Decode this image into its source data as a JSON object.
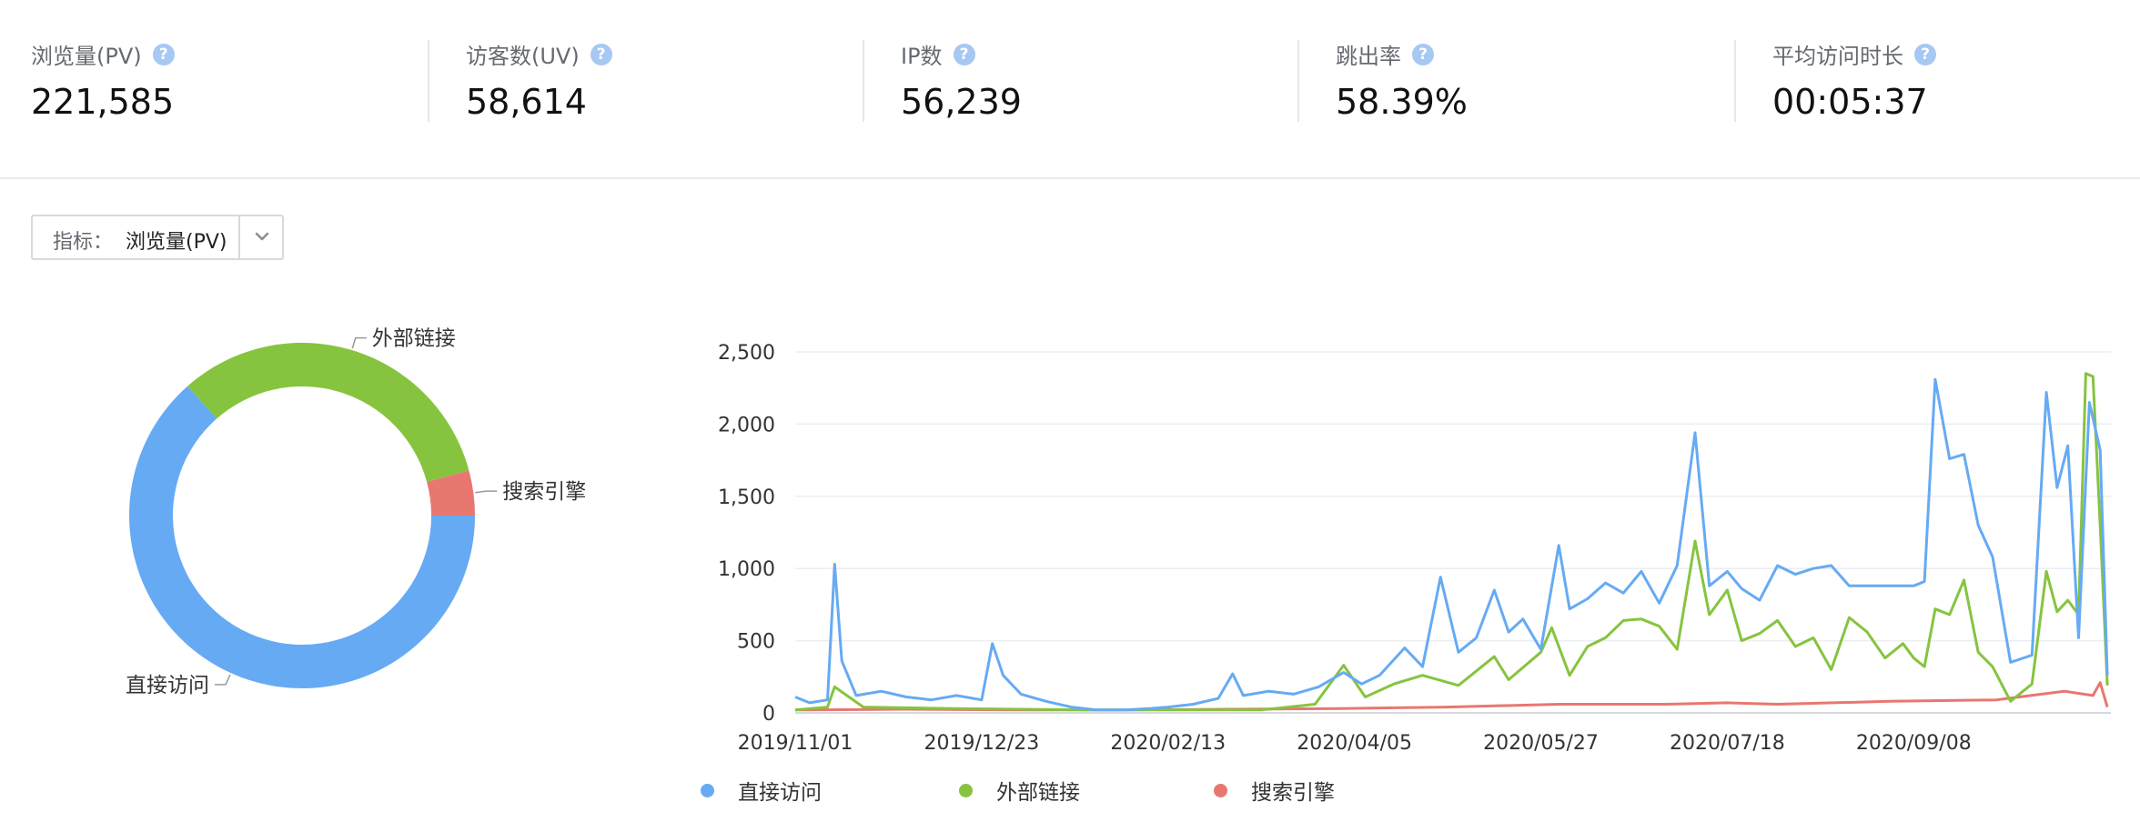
{
  "stats": [
    {
      "label": "浏览量(PV)",
      "value": "221,585"
    },
    {
      "label": "访客数(UV)",
      "value": "58,614"
    },
    {
      "label": "IP数",
      "value": "56,239"
    },
    {
      "label": "跳出率",
      "value": "58.39%"
    },
    {
      "label": "平均访问时长",
      "value": "00:05:37"
    }
  ],
  "metric_selector": {
    "prefix": "指标：",
    "value": "浏览量(PV)"
  },
  "chart_data": [
    {
      "type": "pie",
      "variant": "donut",
      "slices": [
        {
          "name": "直接访问",
          "value": 63.5,
          "color": "#66aaf4"
        },
        {
          "name": "外部链接",
          "value": 32.3,
          "color": "#86c43f"
        },
        {
          "name": "搜索引擎",
          "value": 4.2,
          "color": "#e87770"
        }
      ],
      "labels_outside": true
    },
    {
      "type": "line",
      "x_range": [
        "2019/11/01",
        "2020/11/02"
      ],
      "x_tick_labels": [
        "2019/11/01",
        "2019/12/23",
        "2020/02/13",
        "2020/04/05",
        "2020/05/27",
        "2020/07/18",
        "2020/09/08"
      ],
      "y_ticks": [
        "0",
        "500",
        "1,000",
        "1,500",
        "2,000",
        "2,500"
      ],
      "ylim": [
        0,
        2500
      ],
      "grid": "horizontal",
      "legend_position": "bottom",
      "series": [
        {
          "name": "直接访问",
          "color": "#66aaf4",
          "points": [
            [
              "2019/11/01",
              110
            ],
            [
              "2019/11/05",
              70
            ],
            [
              "2019/11/10",
              90
            ],
            [
              "2019/11/12",
              1030
            ],
            [
              "2019/11/14",
              360
            ],
            [
              "2019/11/18",
              120
            ],
            [
              "2019/11/25",
              150
            ],
            [
              "2019/12/02",
              110
            ],
            [
              "2019/12/09",
              90
            ],
            [
              "2019/12/16",
              120
            ],
            [
              "2019/12/23",
              90
            ],
            [
              "2019/12/26",
              480
            ],
            [
              "2019/12/29",
              260
            ],
            [
              "2020/01/03",
              130
            ],
            [
              "2020/01/10",
              80
            ],
            [
              "2020/01/17",
              40
            ],
            [
              "2020/01/24",
              20
            ],
            [
              "2020/02/01",
              20
            ],
            [
              "2020/02/08",
              30
            ],
            [
              "2020/02/13",
              40
            ],
            [
              "2020/02/20",
              60
            ],
            [
              "2020/02/27",
              100
            ],
            [
              "2020/03/02",
              270
            ],
            [
              "2020/03/05",
              120
            ],
            [
              "2020/03/12",
              150
            ],
            [
              "2020/03/19",
              130
            ],
            [
              "2020/03/26",
              180
            ],
            [
              "2020/04/02",
              280
            ],
            [
              "2020/04/07",
              200
            ],
            [
              "2020/04/12",
              260
            ],
            [
              "2020/04/19",
              450
            ],
            [
              "2020/04/24",
              320
            ],
            [
              "2020/04/29",
              940
            ],
            [
              "2020/05/04",
              420
            ],
            [
              "2020/05/09",
              520
            ],
            [
              "2020/05/14",
              850
            ],
            [
              "2020/05/18",
              560
            ],
            [
              "2020/05/22",
              650
            ],
            [
              "2020/05/27",
              440
            ],
            [
              "2020/06/01",
              1160
            ],
            [
              "2020/06/04",
              720
            ],
            [
              "2020/06/09",
              790
            ],
            [
              "2020/06/14",
              900
            ],
            [
              "2020/06/19",
              830
            ],
            [
              "2020/06/24",
              980
            ],
            [
              "2020/06/29",
              760
            ],
            [
              "2020/07/04",
              1020
            ],
            [
              "2020/07/09",
              1940
            ],
            [
              "2020/07/13",
              880
            ],
            [
              "2020/07/18",
              980
            ],
            [
              "2020/07/22",
              860
            ],
            [
              "2020/07/27",
              780
            ],
            [
              "2020/08/01",
              1020
            ],
            [
              "2020/08/06",
              960
            ],
            [
              "2020/08/11",
              1000
            ],
            [
              "2020/08/16",
              1020
            ],
            [
              "2020/08/21",
              880
            ],
            [
              "2020/08/26",
              880
            ],
            [
              "2020/08/31",
              880
            ],
            [
              "2020/09/05",
              880
            ],
            [
              "2020/09/08",
              880
            ],
            [
              "2020/09/11",
              910
            ],
            [
              "2020/09/14",
              2310
            ],
            [
              "2020/09/18",
              1760
            ],
            [
              "2020/09/22",
              1790
            ],
            [
              "2020/09/26",
              1300
            ],
            [
              "2020/09/30",
              1080
            ],
            [
              "2020/10/05",
              350
            ],
            [
              "2020/10/11",
              400
            ],
            [
              "2020/10/15",
              2220
            ],
            [
              "2020/10/18",
              1560
            ],
            [
              "2020/10/21",
              1850
            ],
            [
              "2020/10/24",
              520
            ],
            [
              "2020/10/27",
              2150
            ],
            [
              "2020/10/30",
              1820
            ],
            [
              "2020/11/01",
              260
            ]
          ]
        },
        {
          "name": "外部链接",
          "color": "#86c43f",
          "points": [
            [
              "2019/11/01",
              20
            ],
            [
              "2019/11/10",
              40
            ],
            [
              "2019/11/12",
              180
            ],
            [
              "2019/11/20",
              40
            ],
            [
              "2019/12/15",
              30
            ],
            [
              "2020/01/20",
              20
            ],
            [
              "2020/02/10",
              20
            ],
            [
              "2020/03/10",
              20
            ],
            [
              "2020/03/25",
              60
            ],
            [
              "2020/04/02",
              330
            ],
            [
              "2020/04/08",
              110
            ],
            [
              "2020/04/16",
              200
            ],
            [
              "2020/04/24",
              260
            ],
            [
              "2020/05/04",
              190
            ],
            [
              "2020/05/14",
              390
            ],
            [
              "2020/05/18",
              230
            ],
            [
              "2020/05/27",
              420
            ],
            [
              "2020/05/30",
              590
            ],
            [
              "2020/06/04",
              260
            ],
            [
              "2020/06/09",
              460
            ],
            [
              "2020/06/14",
              520
            ],
            [
              "2020/06/19",
              640
            ],
            [
              "2020/06/24",
              650
            ],
            [
              "2020/06/29",
              600
            ],
            [
              "2020/07/04",
              440
            ],
            [
              "2020/07/09",
              1190
            ],
            [
              "2020/07/13",
              680
            ],
            [
              "2020/07/18",
              850
            ],
            [
              "2020/07/22",
              500
            ],
            [
              "2020/07/27",
              550
            ],
            [
              "2020/08/01",
              640
            ],
            [
              "2020/08/06",
              460
            ],
            [
              "2020/08/11",
              520
            ],
            [
              "2020/08/16",
              300
            ],
            [
              "2020/08/21",
              660
            ],
            [
              "2020/08/26",
              560
            ],
            [
              "2020/08/31",
              380
            ],
            [
              "2020/09/05",
              480
            ],
            [
              "2020/09/08",
              380
            ],
            [
              "2020/09/11",
              320
            ],
            [
              "2020/09/14",
              720
            ],
            [
              "2020/09/18",
              680
            ],
            [
              "2020/09/22",
              920
            ],
            [
              "2020/09/26",
              420
            ],
            [
              "2020/09/30",
              320
            ],
            [
              "2020/10/05",
              80
            ],
            [
              "2020/10/11",
              200
            ],
            [
              "2020/10/15",
              980
            ],
            [
              "2020/10/18",
              700
            ],
            [
              "2020/10/21",
              780
            ],
            [
              "2020/10/24",
              680
            ],
            [
              "2020/10/26",
              2350
            ],
            [
              "2020/10/28",
              2330
            ],
            [
              "2020/10/30",
              1300
            ],
            [
              "2020/11/01",
              190
            ]
          ]
        },
        {
          "name": "搜索引擎",
          "color": "#e87770",
          "points": [
            [
              "2019/11/01",
              20
            ],
            [
              "2019/12/01",
              25
            ],
            [
              "2020/01/01",
              20
            ],
            [
              "2020/02/01",
              20
            ],
            [
              "2020/03/01",
              25
            ],
            [
              "2020/04/01",
              30
            ],
            [
              "2020/05/01",
              40
            ],
            [
              "2020/06/01",
              60
            ],
            [
              "2020/07/01",
              60
            ],
            [
              "2020/07/18",
              70
            ],
            [
              "2020/08/01",
              60
            ],
            [
              "2020/09/01",
              80
            ],
            [
              "2020/10/01",
              90
            ],
            [
              "2020/10/20",
              150
            ],
            [
              "2020/10/28",
              120
            ],
            [
              "2020/10/30",
              210
            ],
            [
              "2020/11/01",
              40
            ]
          ]
        }
      ]
    }
  ]
}
